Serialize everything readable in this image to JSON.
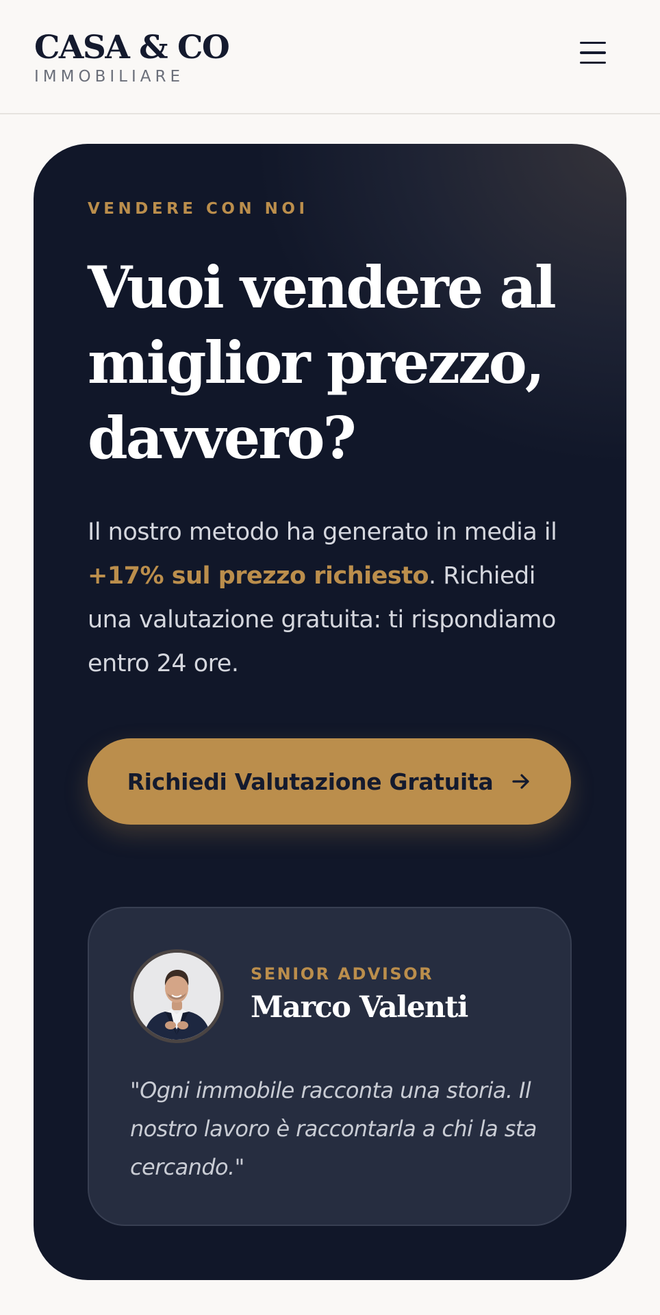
{
  "brand": {
    "name": "CASA & CO",
    "subtitle": "IMMOBILIARE"
  },
  "header": {
    "menu_icon": "hamburger-menu-icon"
  },
  "hero": {
    "eyebrow": "VENDERE CON NOI",
    "headline_lines": [
      "Vuoi vendere al",
      "miglior prezzo,",
      "davvero?"
    ],
    "intro_before": "Il nostro metodo ha generato in media il ",
    "intro_highlight": "+17% sul prezzo richiesto",
    "intro_after": ". Richiedi una valutazione gratuita: ti rispondiamo entro 24 ore.",
    "cta_label": "Richiedi Valutazione Gratuita",
    "cta_icon": "arrow-right-icon"
  },
  "advisor": {
    "role": "SENIOR ADVISOR",
    "name": "Marco Valenti",
    "quote": "\"Ogni immobile racconta una storia. Il nostro lavoro è raccontarla a chi la sta cercando.\""
  },
  "colors": {
    "accent_gold": "#bb8e4c",
    "navy": "#141a2e",
    "card_bg": "#262d40",
    "page_bg": "#faf8f6"
  }
}
